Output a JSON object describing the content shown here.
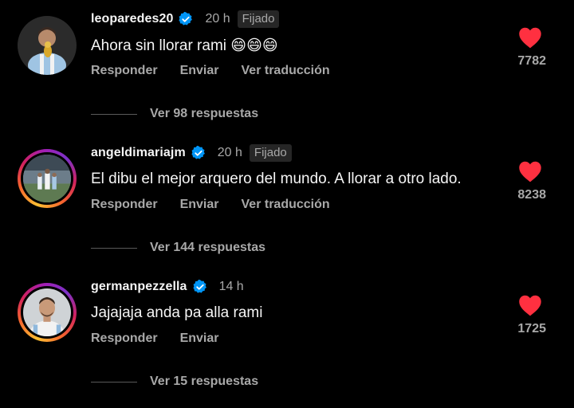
{
  "colors": {
    "background": "#000000",
    "text_primary": "#f5f5f5",
    "text_secondary": "#a8a8a8",
    "heart": "#ff3040",
    "verified": "#0095f6"
  },
  "comments": [
    {
      "username": "leoparedes20",
      "verified": true,
      "time": "20 h",
      "pinned_label": "Fijado",
      "text": "Ahora sin llorar rami 😄😄😄",
      "actions": [
        "Responder",
        "Enviar",
        "Ver traducción"
      ],
      "liked": true,
      "likes": "7782",
      "replies_label": "Ver 98 respuestas",
      "avatar_icon": "player-with-trophy-avatar",
      "story_ring": false
    },
    {
      "username": "angeldimariajm",
      "verified": true,
      "time": "20 h",
      "pinned_label": "Fijado",
      "text": "El dibu el mejor arquero del mundo. A llorar a otro lado.",
      "actions": [
        "Responder",
        "Enviar",
        "Ver traducción"
      ],
      "liked": true,
      "likes": "8238",
      "replies_label": "Ver 144 respuestas",
      "avatar_icon": "stadium-group-avatar",
      "story_ring": true
    },
    {
      "username": "germanpezzella",
      "verified": true,
      "time": "14 h",
      "pinned_label": "",
      "text": "Jajajaja anda pa alla rami",
      "actions": [
        "Responder",
        "Enviar"
      ],
      "liked": true,
      "likes": "1725",
      "replies_label": "Ver 15 respuestas",
      "avatar_icon": "player-portrait-avatar",
      "story_ring": true
    }
  ]
}
